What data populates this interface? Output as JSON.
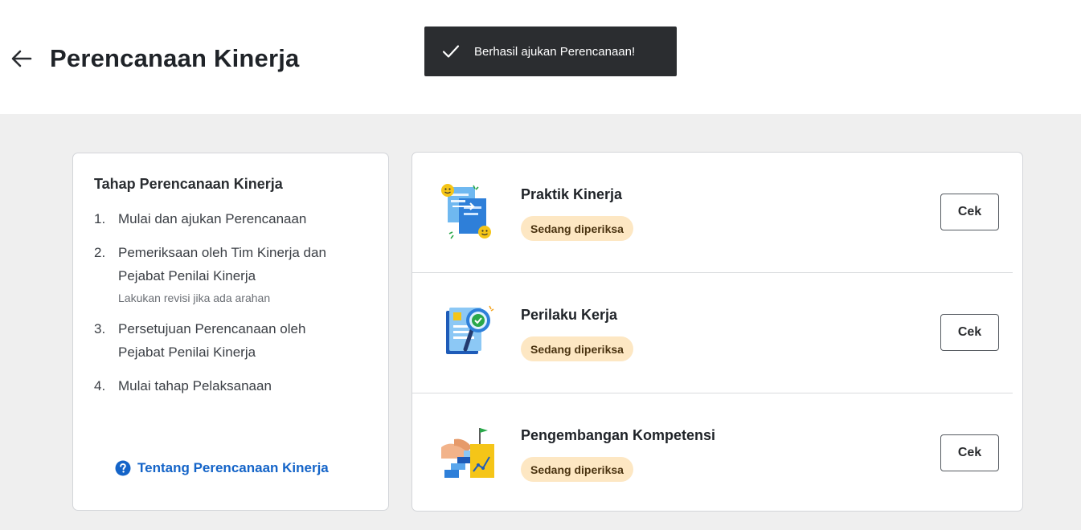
{
  "header": {
    "title": "Perencanaan Kinerja",
    "back_icon": "arrow-left-icon"
  },
  "toast": {
    "message": "Berhasil ajukan Perencanaan!",
    "icon": "check-icon"
  },
  "steps_card": {
    "title": "Tahap Perencanaan Kinerja",
    "steps": [
      {
        "number": "1.",
        "text": "Mulai dan ajukan Perencanaan",
        "note": ""
      },
      {
        "number": "2.",
        "text": "Pemeriksaan oleh Tim Kinerja dan Pejabat Penilai Kinerja",
        "note": "Lakukan revisi jika ada arahan"
      },
      {
        "number": "3.",
        "text": "Persetujuan Perencanaan oleh Pejabat Penilai Kinerja",
        "note": ""
      },
      {
        "number": "4.",
        "text": "Mulai tahap Pelaksanaan",
        "note": ""
      }
    ],
    "about_link": "Tentang Perencanaan Kinerja",
    "about_icon": "question-circle-icon"
  },
  "items": [
    {
      "title": "Praktik Kinerja",
      "status": "Sedang diperiksa",
      "button": "Cek",
      "illustration": "documents-smiley-illustration"
    },
    {
      "title": "Perilaku Kerja",
      "status": "Sedang diperiksa",
      "button": "Cek",
      "illustration": "checklist-magnifier-illustration"
    },
    {
      "title": "Pengembangan Kompetensi",
      "status": "Sedang diperiksa",
      "button": "Cek",
      "illustration": "stairs-flag-illustration"
    }
  ],
  "colors": {
    "link": "#1464c8",
    "badge_bg": "#fde7c3",
    "toast_bg": "#2b2d30",
    "content_bg": "#efefef"
  }
}
